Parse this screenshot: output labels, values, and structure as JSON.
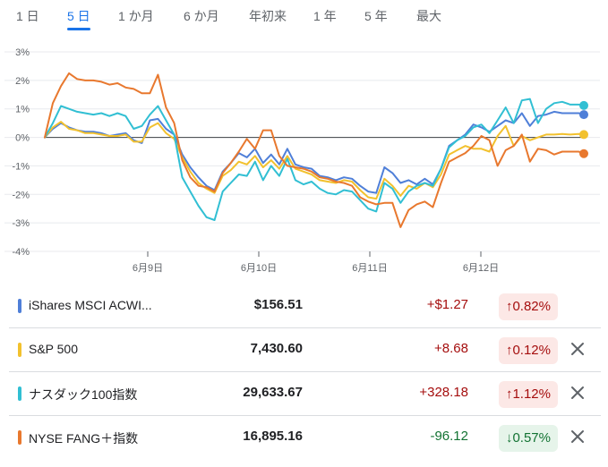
{
  "tabs": [
    {
      "label": "1 日",
      "active": false
    },
    {
      "label": "5 日",
      "active": true
    },
    {
      "label": "1 か月",
      "active": false
    },
    {
      "label": "6 か月",
      "active": false
    },
    {
      "label": "年初来",
      "active": false
    },
    {
      "label": "1 年",
      "active": false
    },
    {
      "label": "5 年",
      "active": false
    },
    {
      "label": "最大",
      "active": false
    }
  ],
  "rows": [
    {
      "name": "iShares MSCI ACWI...",
      "price": "$156.51",
      "change": "+$1.27",
      "pct": "0.82%",
      "direction": "up",
      "color": "#4f7fd8",
      "removable": false
    },
    {
      "name": "S&P 500",
      "price": "7,430.60",
      "change": "+8.68",
      "pct": "0.12%",
      "direction": "up",
      "color": "#f2c12e",
      "removable": true
    },
    {
      "name": "ナスダック100指数",
      "price": "29,633.67",
      "change": "+328.18",
      "pct": "1.12%",
      "direction": "up",
      "color": "#31bfd3",
      "removable": true
    },
    {
      "name": "NYSE FANG＋指数",
      "price": "16,895.16",
      "change": "-96.12",
      "pct": "0.57%",
      "direction": "down",
      "color": "#e8782e",
      "removable": true
    }
  ],
  "colors": {
    "up_text": "#a50e0e",
    "down_text": "#137333",
    "up_bg": "#fce8e6",
    "down_bg": "#e6f4ea"
  },
  "chart_data": {
    "type": "line",
    "y_ticks": [
      "3%",
      "2%",
      "1%",
      "0%",
      "-1%",
      "-2%",
      "-3%",
      "-4%"
    ],
    "ylim": [
      -4,
      3
    ],
    "x_ticks": [
      "6月9日",
      "6月10日",
      "6月11日",
      "6月12日"
    ],
    "grid": true,
    "baseline": 0,
    "series": [
      {
        "name": "iShares MSCI ACWI...",
        "color": "#4f7fd8",
        "values": [
          0,
          0.3,
          0.5,
          0.35,
          0.25,
          0.2,
          0.2,
          0.15,
          0.05,
          0.1,
          0.15,
          -0.1,
          -0.2,
          0.6,
          0.65,
          0.3,
          0.1,
          -0.6,
          -1.05,
          -1.4,
          -1.7,
          -1.85,
          -1.2,
          -0.9,
          -0.55,
          -0.7,
          -0.4,
          -0.9,
          -0.6,
          -0.95,
          -0.4,
          -0.95,
          -1.05,
          -1.1,
          -1.35,
          -1.4,
          -1.5,
          -1.4,
          -1.45,
          -1.7,
          -1.9,
          -1.95,
          -1.05,
          -1.25,
          -1.6,
          -1.5,
          -1.65,
          -1.45,
          -1.65,
          -1.1,
          -0.3,
          -0.1,
          0.1,
          0.45,
          0.35,
          0.2,
          0.4,
          0.6,
          0.5,
          0.85,
          0.4,
          0.75,
          0.8,
          0.9,
          0.85,
          0.85,
          0.85,
          0.8
        ]
      },
      {
        "name": "S&P 500",
        "color": "#f2c12e",
        "values": [
          0,
          0.35,
          0.55,
          0.3,
          0.25,
          0.15,
          0.15,
          0.1,
          0.05,
          0.05,
          0.1,
          -0.15,
          -0.15,
          0.35,
          0.5,
          0.15,
          -0.05,
          -0.7,
          -1.2,
          -1.6,
          -1.8,
          -1.95,
          -1.35,
          -1.15,
          -0.85,
          -0.95,
          -0.65,
          -1.05,
          -0.8,
          -1.1,
          -0.65,
          -1.1,
          -1.2,
          -1.3,
          -1.5,
          -1.55,
          -1.6,
          -1.5,
          -1.55,
          -1.85,
          -2.1,
          -2.15,
          -1.45,
          -1.7,
          -2.05,
          -1.7,
          -1.8,
          -1.6,
          -1.75,
          -1.3,
          -0.6,
          -0.45,
          -0.3,
          -0.4,
          -0.4,
          -0.5,
          0.05,
          0.4,
          -0.3,
          0.05,
          -0.1,
          0.0,
          0.1,
          0.1,
          0.12,
          0.1,
          0.12,
          0.1
        ]
      },
      {
        "name": "ナスダック100指数",
        "color": "#31bfd3",
        "values": [
          0,
          0.5,
          1.1,
          1.0,
          0.9,
          0.85,
          0.8,
          0.85,
          0.75,
          0.85,
          0.75,
          0.3,
          0.4,
          0.8,
          1.1,
          0.6,
          0.1,
          -1.4,
          -1.9,
          -2.4,
          -2.8,
          -2.9,
          -1.9,
          -1.6,
          -1.3,
          -1.35,
          -0.85,
          -1.5,
          -1.0,
          -1.35,
          -0.75,
          -1.5,
          -1.65,
          -1.55,
          -1.8,
          -1.95,
          -2.0,
          -1.85,
          -1.9,
          -2.2,
          -2.5,
          -2.6,
          -1.6,
          -1.8,
          -2.3,
          -1.9,
          -1.7,
          -1.6,
          -1.7,
          -1.1,
          -0.35,
          -0.1,
          0.05,
          0.35,
          0.45,
          0.15,
          0.6,
          1.05,
          0.5,
          1.3,
          1.35,
          0.5,
          1.0,
          1.2,
          1.25,
          1.15,
          1.15,
          1.12
        ]
      },
      {
        "name": "NYSE FANG＋指数",
        "color": "#e8782e",
        "values": [
          0,
          1.2,
          1.8,
          2.25,
          2.05,
          2.0,
          2.0,
          1.95,
          1.85,
          1.9,
          1.75,
          1.7,
          1.55,
          1.55,
          2.2,
          1.05,
          0.5,
          -0.8,
          -1.4,
          -1.7,
          -1.75,
          -1.9,
          -1.25,
          -0.9,
          -0.5,
          -0.05,
          -0.4,
          0.25,
          0.25,
          -0.65,
          -1.0,
          -1.05,
          -1.1,
          -1.2,
          -1.4,
          -1.45,
          -1.55,
          -1.6,
          -1.7,
          -2.1,
          -2.25,
          -2.35,
          -2.3,
          -2.3,
          -3.15,
          -2.55,
          -2.35,
          -2.25,
          -2.45,
          -1.6,
          -0.85,
          -0.7,
          -0.55,
          -0.3,
          0.05,
          -0.1,
          -1.0,
          -0.45,
          -0.3,
          0.1,
          -0.85,
          -0.4,
          -0.45,
          -0.6,
          -0.5,
          -0.5,
          -0.5,
          -0.57
        ]
      }
    ]
  }
}
